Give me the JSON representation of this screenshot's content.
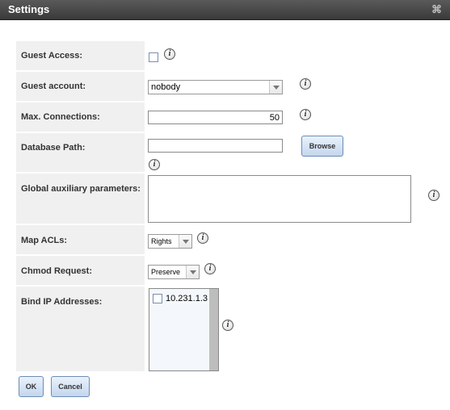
{
  "window": {
    "title": "Settings",
    "close_glyph": "⌘"
  },
  "info_glyph": "i",
  "fields": {
    "guest_access": {
      "label": "Guest Access:",
      "checked": false
    },
    "guest_account": {
      "label": "Guest account:",
      "value": "nobody"
    },
    "max_connections": {
      "label": "Max. Connections:",
      "value": "50"
    },
    "database_path": {
      "label": "Database Path:",
      "value": "",
      "browse_label": "Browse"
    },
    "global_aux": {
      "label": "Global auxiliary parameters:",
      "value": ""
    },
    "map_acls": {
      "label": "Map ACLs:",
      "value": "Rights"
    },
    "chmod_request": {
      "label": "Chmod Request:",
      "value": "Preserve"
    },
    "bind_ip": {
      "label": "Bind IP Addresses:",
      "options": [
        {
          "label": "10.231.1.3",
          "checked": false
        }
      ]
    }
  },
  "footer": {
    "ok_label": "OK",
    "cancel_label": "Cancel"
  },
  "colors": {
    "label_bg": "#f0f0f0",
    "button_border": "#6d8cb5",
    "titlebar": "#4a4a4a"
  },
  "icons": [
    "close-icon",
    "info-icon",
    "dropdown-arrow-icon"
  ]
}
